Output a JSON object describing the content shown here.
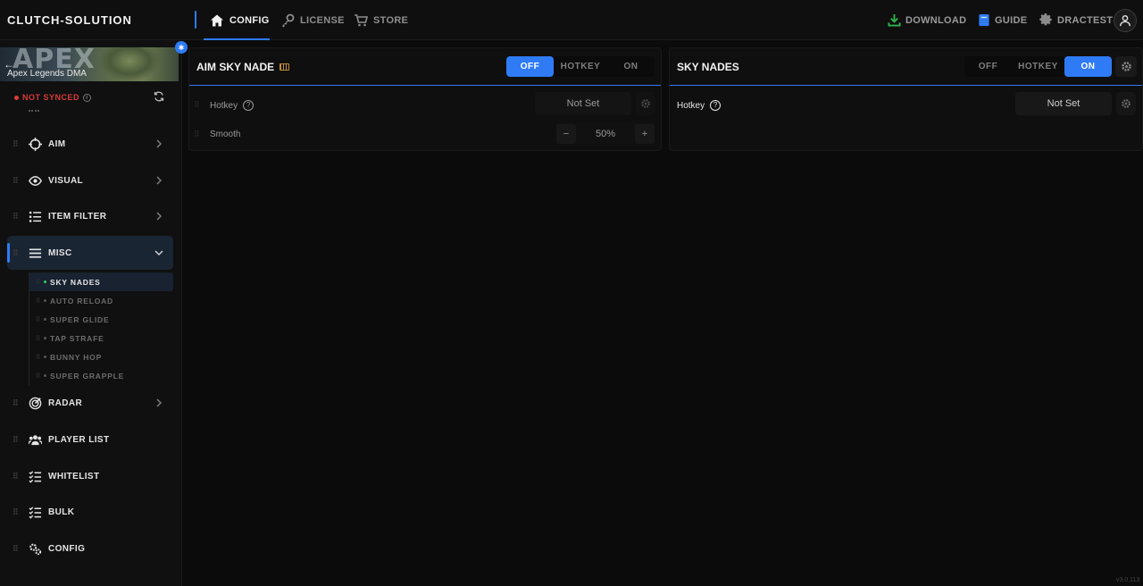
{
  "brand": "CLUTCH-SOLUTION",
  "nav": {
    "config": "CONFIG",
    "license": "LICENSE",
    "store": "STORE",
    "download": "DOWNLOAD",
    "guide": "GUIDE",
    "user": "DRACTEST"
  },
  "game": {
    "banner_text": "APEX",
    "subtitle": "Apex Legends DMA"
  },
  "sync_status": "NOT SYNCED",
  "sidebar": {
    "items": [
      {
        "label": "AIM",
        "icon": "crosshair-icon"
      },
      {
        "label": "VISUAL",
        "icon": "eye-icon"
      },
      {
        "label": "ITEM FILTER",
        "icon": "list-icon"
      },
      {
        "label": "MISC",
        "icon": "menu-icon"
      },
      {
        "label": "RADAR",
        "icon": "radar-icon"
      },
      {
        "label": "PLAYER LIST",
        "icon": "users-icon"
      },
      {
        "label": "WHITELIST",
        "icon": "checklist-icon"
      },
      {
        "label": "BULK",
        "icon": "checklist-icon"
      },
      {
        "label": "CONFIG",
        "icon": "gears-icon"
      }
    ],
    "misc_sub": [
      "SKY NADES",
      "AUTO RELOAD",
      "SUPER GLIDE",
      "TAP STRAFE",
      "BUNNY HOP",
      "SUPER GRAPPLE"
    ]
  },
  "panels": {
    "aim_sky_nade": {
      "title": "AIM SKY NADE",
      "toggle": [
        "OFF",
        "HOTKEY",
        "ON"
      ],
      "selected": "OFF",
      "hotkey_label": "Hotkey",
      "hotkey_value": "Not Set",
      "smooth_label": "Smooth",
      "smooth_value": "50%",
      "minus": "−",
      "plus": "+"
    },
    "sky_nades": {
      "title": "SKY NADES",
      "toggle": [
        "OFF",
        "HOTKEY",
        "ON"
      ],
      "selected": "ON",
      "hotkey_label": "Hotkey",
      "hotkey_value": "Not Set"
    }
  },
  "version": "v3.0.113",
  "colors": {
    "accent": "#2f7bf5",
    "error": "#e23b3b",
    "success": "#2fd35a"
  }
}
